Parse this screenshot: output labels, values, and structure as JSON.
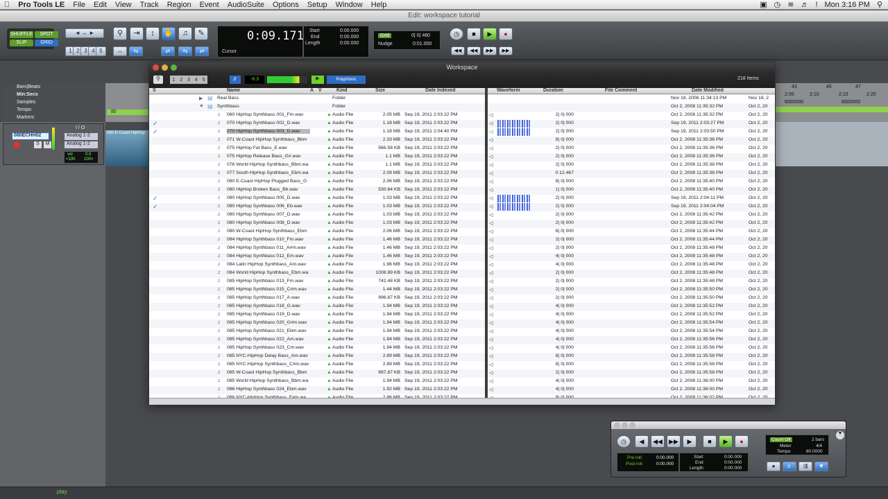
{
  "menubar": {
    "app": "Pro Tools LE",
    "items": [
      "File",
      "Edit",
      "View",
      "Track",
      "Region",
      "Event",
      "AudioSuite",
      "Options",
      "Setup",
      "Window",
      "Help"
    ],
    "clock": "Mon 3:16 PM"
  },
  "edit_window": {
    "title": "Edit: workspace tutorial",
    "modes": [
      "SHUFFLE",
      "SPOT",
      "SLIP",
      "GRID"
    ],
    "zoom_presets": [
      "1",
      "2",
      "3",
      "4",
      "5"
    ],
    "counter": {
      "main": "0:09.171",
      "label": "Cursor"
    },
    "selection": {
      "labels": [
        "Start",
        "End",
        "Length"
      ],
      "values": [
        "0:00.000",
        "0:00.000",
        "0:00.000"
      ]
    },
    "grid": {
      "grid_label": "Grid",
      "grid_value": "0| 0| 480",
      "nudge_label": "Nudge",
      "nudge_value": "0:01.000"
    },
    "rulers": [
      "Bars|Beats",
      "Min:Secs",
      "Samples",
      "Tempo",
      "Markers"
    ],
    "tempo_value": "80",
    "track": {
      "name": "080ECHH02",
      "io_header": "I / O",
      "input": "Analog 1-2",
      "output": "Analog 1-2",
      "vol": "vol",
      "vol_value": "0.0",
      "pan_left": "<100",
      "pan_right": "100>",
      "region_name": "080 E-Coast HipHop"
    },
    "ruler_right": {
      "bars": [
        "43",
        "45",
        "47"
      ],
      "mins": [
        "2:05",
        "2:10",
        "2:15",
        "2:20"
      ],
      "samples": [
        "6000000",
        "6500000"
      ]
    },
    "footer_status": "play"
  },
  "workspace": {
    "title": "Workspace",
    "item_count": "218 Items",
    "pages": [
      "1",
      "2",
      "3",
      "4",
      "5"
    ],
    "preview_level": "-8.3",
    "polyphonic": "Polyphonic",
    "columns": [
      "S",
      "Name",
      "A",
      "V",
      "Kind",
      "Size",
      "Date Indexed",
      "Waveform",
      "Duration",
      "File Comment",
      "Date Modified"
    ],
    "rows": [
      {
        "name": "Real Bass",
        "kind": "Folder",
        "size": "",
        "indexed": "",
        "duration": "",
        "modified": "Nov 18, 2008 11:34:13 PM",
        "modified2": "Nov 18, 2",
        "folder": true,
        "open": false
      },
      {
        "name": "Synthbass",
        "kind": "Folder",
        "size": "",
        "indexed": "",
        "duration": "",
        "modified": "Oct 2, 2008 11:35:32 PM",
        "modified2": "Oct 2, 20",
        "folder": true,
        "open": true
      },
      {
        "name": "060 HipHop Synthbass 001_Fm.wav",
        "kind": "Audio File",
        "size": "2.05 MB",
        "indexed": "Sep 19, 2011 2:03:22 PM",
        "duration": "2| 0| 000",
        "modified": "Oct 2, 2008 11:35:32 PM",
        "modified2": "Oct 2, 20"
      },
      {
        "name": "070 HipHop Synthbass 002_D.wav",
        "kind": "Audio File",
        "size": "1.18 MB",
        "indexed": "Sep 19, 2011 2:03:22 PM",
        "duration": "2| 0| 000",
        "modified": "Sep 19, 2011 2:03:27 PM",
        "modified2": "Oct 2, 20",
        "check": true,
        "wave": true
      },
      {
        "name": "070 HipHop Synthbass 003_D.wav",
        "kind": "Audio File",
        "size": "1.18 MB",
        "indexed": "Sep 19, 2011 2:04:40 PM",
        "duration": "2| 0| 000",
        "modified": "Sep 19, 2011 2:03:50 PM",
        "modified2": "Oct 2, 20",
        "check": true,
        "selected": true,
        "playing": true
      },
      {
        "name": "071 W-Coast HipHop Synthbass_Bbm",
        "kind": "Audio File",
        "size": "2.33 MB",
        "indexed": "Sep 19, 2011 2:03:22 PM",
        "duration": "8| 0| 000",
        "modified": "Oct 2, 2008 11:35:36 PM",
        "modified2": "Oct 2, 20"
      },
      {
        "name": "075 HipHop Fat Bass_E.wav",
        "kind": "Audio File",
        "size": "566.58 KB",
        "indexed": "Sep 19, 2011 2:03:22 PM",
        "duration": "2| 0| 000",
        "modified": "Oct 2, 2008 11:35:36 PM",
        "modified2": "Oct 2, 20"
      },
      {
        "name": "075 HipHop Release Bass_G#.wav",
        "kind": "Audio File",
        "size": "1.1 MB",
        "indexed": "Sep 19, 2011 2:03:22 PM",
        "duration": "2| 0| 000",
        "modified": "Oct 2, 2008 11:35:36 PM",
        "modified2": "Oct 2, 20"
      },
      {
        "name": "076 World HipHop Synthbass_Bbm.wa",
        "kind": "Audio File",
        "size": "1.1 MB",
        "indexed": "Sep 19, 2011 2:03:22 PM",
        "duration": "2| 0| 000",
        "modified": "Oct 2, 2008 11:35:38 PM",
        "modified2": "Oct 2, 20"
      },
      {
        "name": "077 South HipHop Synthbass_Ebm.wa",
        "kind": "Audio File",
        "size": "2.09 MB",
        "indexed": "Sep 19, 2011 2:03:22 PM",
        "duration": "0:12.467",
        "modified": "Oct 2, 2008 11:35:38 PM",
        "modified2": "Oct 2, 20",
        "alt": true
      },
      {
        "name": "080 E-Coast HipHop Plugged Bass_G",
        "kind": "Audio File",
        "size": "2.06 MB",
        "indexed": "Sep 19, 2011 2:03:22 PM",
        "duration": "8| 0| 000",
        "modified": "Oct 2, 2008 11:35:40 PM",
        "modified2": "Oct 2, 20"
      },
      {
        "name": "080 HipHop Broken Bass_Bb.wav",
        "kind": "Audio File",
        "size": "530.64 KB",
        "indexed": "Sep 19, 2011 2:03:22 PM",
        "duration": "1| 0| 000",
        "modified": "Oct 2, 2008 11:35:40 PM",
        "modified2": "Oct 2, 20"
      },
      {
        "name": "080 HipHop Synthbass 005_D.wav",
        "kind": "Audio File",
        "size": "1.03 MB",
        "indexed": "Sep 19, 2011 2:03:22 PM",
        "duration": "2| 0| 000",
        "modified": "Sep 19, 2011 2:04:11 PM",
        "modified2": "Oct 2, 20",
        "check": true,
        "wave": true
      },
      {
        "name": "080 HipHop Synthbass 006_Eb.wav",
        "kind": "Audio File",
        "size": "1.03 MB",
        "indexed": "Sep 19, 2011 2:03:22 PM",
        "duration": "2| 0| 000",
        "modified": "Sep 19, 2011 2:04:04 PM",
        "modified2": "Oct 2, 20",
        "check": true,
        "wave": true
      },
      {
        "name": "080 HipHop Synthbass 007_D.wav",
        "kind": "Audio File",
        "size": "1.03 MB",
        "indexed": "Sep 19, 2011 2:03:22 PM",
        "duration": "2| 0| 000",
        "modified": "Oct 2, 2008 11:35:42 PM",
        "modified2": "Oct 2, 20"
      },
      {
        "name": "080 HipHop Synthbass 008_D.wav",
        "kind": "Audio File",
        "size": "1.03 MB",
        "indexed": "Sep 19, 2011 2:03:22 PM",
        "duration": "2| 0| 000",
        "modified": "Oct 2, 2008 11:35:42 PM",
        "modified2": "Oct 2, 20"
      },
      {
        "name": "080 W-Coast HipHop Synthbass_Ebm",
        "kind": "Audio File",
        "size": "2.06 MB",
        "indexed": "Sep 19, 2011 2:03:22 PM",
        "duration": "8| 0| 000",
        "modified": "Oct 2, 2008 11:35:44 PM",
        "modified2": "Oct 2, 20"
      },
      {
        "name": "084 HipHop Synthbass 010_Fm.wav",
        "kind": "Audio File",
        "size": "1.46 MB",
        "indexed": "Sep 19, 2011 2:03:22 PM",
        "duration": "2| 0| 000",
        "modified": "Oct 2, 2008 11:35:44 PM",
        "modified2": "Oct 2, 20"
      },
      {
        "name": "084 HipHop Synthbass 011_A#m.wav",
        "kind": "Audio File",
        "size": "1.46 MB",
        "indexed": "Sep 19, 2011 2:03:22 PM",
        "duration": "2| 0| 000",
        "modified": "Oct 2, 2008 11:35:48 PM",
        "modified2": "Oct 2, 20"
      },
      {
        "name": "084 HipHop Synthbass 012_Em.wav",
        "kind": "Audio File",
        "size": "1.46 MB",
        "indexed": "Sep 19, 2011 2:03:22 PM",
        "duration": "4| 0| 000",
        "modified": "Oct 2, 2008 11:35:48 PM",
        "modified2": "Oct 2, 20"
      },
      {
        "name": "084 Latin HipHop Synthbass_Am.wav",
        "kind": "Audio File",
        "size": "1.96 MB",
        "indexed": "Sep 19, 2011 2:03:22 PM",
        "duration": "4| 0| 000",
        "modified": "Oct 2, 2008 11:35:48 PM",
        "modified2": "Oct 2, 20"
      },
      {
        "name": "084 World HipHop Synthbass_Ebm.wa",
        "kind": "Audio File",
        "size": "1008.89 KB",
        "indexed": "Sep 19, 2011 2:03:22 PM",
        "duration": "2| 0| 000",
        "modified": "Oct 2, 2008 11:35:48 PM",
        "modified2": "Oct 2, 20"
      },
      {
        "name": "085 HipHop Synthbass 013_Fm.wav",
        "kind": "Audio File",
        "size": "742.48 KB",
        "indexed": "Sep 19, 2011 2:03:22 PM",
        "duration": "2| 0| 000",
        "modified": "Oct 2, 2008 11:35:48 PM",
        "modified2": "Oct 2, 20"
      },
      {
        "name": "085 HipHop Synthbass 015_C#m.wav",
        "kind": "Audio File",
        "size": "1.44 MB",
        "indexed": "Sep 19, 2011 2:03:22 PM",
        "duration": "2| 0| 000",
        "modified": "Oct 2, 2008 11:35:50 PM",
        "modified2": "Oct 2, 20"
      },
      {
        "name": "085 HipHop Synthbass 017_A.wav",
        "kind": "Audio File",
        "size": "996.87 KB",
        "indexed": "Sep 19, 2011 2:03:22 PM",
        "duration": "2| 0| 000",
        "modified": "Oct 2, 2008 11:35:50 PM",
        "modified2": "Oct 2, 20"
      },
      {
        "name": "085 HipHop Synthbass 018_G.wav",
        "kind": "Audio File",
        "size": "1.94 MB",
        "indexed": "Sep 19, 2011 2:03:22 PM",
        "duration": "4| 0| 000",
        "modified": "Oct 2, 2008 11:35:52 PM",
        "modified2": "Oct 2, 20"
      },
      {
        "name": "085 HipHop Synthbass 019_D.wav",
        "kind": "Audio File",
        "size": "1.94 MB",
        "indexed": "Sep 19, 2011 2:03:22 PM",
        "duration": "4| 0| 000",
        "modified": "Oct 2, 2008 11:35:52 PM",
        "modified2": "Oct 2, 20"
      },
      {
        "name": "085 HipHop Synthbass 020_G#m.wav",
        "kind": "Audio File",
        "size": "1.94 MB",
        "indexed": "Sep 19, 2011 2:03:22 PM",
        "duration": "4| 0| 000",
        "modified": "Oct 2, 2008 11:35:54 PM",
        "modified2": "Oct 2, 20"
      },
      {
        "name": "085 HipHop Synthbass 021_Ebm.wav",
        "kind": "Audio File",
        "size": "1.94 MB",
        "indexed": "Sep 19, 2011 2:03:22 PM",
        "duration": "4| 0| 000",
        "modified": "Oct 2, 2008 11:35:54 PM",
        "modified2": "Oct 2, 20"
      },
      {
        "name": "085 HipHop Synthbass 022_Am.wav",
        "kind": "Audio File",
        "size": "1.94 MB",
        "indexed": "Sep 19, 2011 2:03:22 PM",
        "duration": "4| 0| 000",
        "modified": "Oct 2, 2008 11:35:56 PM",
        "modified2": "Oct 2, 20"
      },
      {
        "name": "085 HipHop Synthbass 023_Cm.wav",
        "kind": "Audio File",
        "size": "1.94 MB",
        "indexed": "Sep 19, 2011 2:03:22 PM",
        "duration": "4| 0| 000",
        "modified": "Oct 2, 2008 11:35:56 PM",
        "modified2": "Oct 2, 20"
      },
      {
        "name": "085 NYC-HipHop Delay Bass_Am.wav",
        "kind": "Audio File",
        "size": "2.89 MB",
        "indexed": "Sep 19, 2011 2:03:22 PM",
        "duration": "8| 0| 000",
        "modified": "Oct 2, 2008 11:35:58 PM",
        "modified2": "Oct 2, 20"
      },
      {
        "name": "085 NYC-HipHop Synthbass_C#m.wav",
        "kind": "Audio File",
        "size": "2.89 MB",
        "indexed": "Sep 19, 2011 2:03:22 PM",
        "duration": "8| 0| 000",
        "modified": "Oct 2, 2008 11:35:58 PM",
        "modified2": "Oct 2, 20"
      },
      {
        "name": "085 W-Coast HipHop Synthbass_Bbm",
        "kind": "Audio File",
        "size": "997.87 KB",
        "indexed": "Sep 19, 2011 2:03:22 PM",
        "duration": "2| 0| 000",
        "modified": "Oct 2, 2008 11:35:58 PM",
        "modified2": "Oct 2, 20"
      },
      {
        "name": "085 World HipHop Synthbass_Bbm.wa",
        "kind": "Audio File",
        "size": "1.94 MB",
        "indexed": "Sep 19, 2011 2:03:22 PM",
        "duration": "4| 0| 000",
        "modified": "Oct 2, 2008 11:36:00 PM",
        "modified2": "Oct 2, 20"
      },
      {
        "name": "086 HipHop Synthbass 024_Ebm.wav",
        "kind": "Audio File",
        "size": "1.92 MB",
        "indexed": "Sep 19, 2011 2:03:22 PM",
        "duration": "4| 0| 000",
        "modified": "Oct 2, 2008 11:36:00 PM",
        "modified2": "Oct 2, 20"
      },
      {
        "name": "086 NYC-HipHop Synthbass_F#m.wa",
        "kind": "Audio File",
        "size": "2.86 MB",
        "indexed": "Sep 19, 2011 2:03:22 PM",
        "duration": "8| 0| 000",
        "modified": "Oct 2, 2008 11:36:02 PM",
        "modified2": "Oct 2, 20"
      }
    ]
  },
  "transport": {
    "preroll_label": "Pre-roll",
    "postroll_label": "Post-roll",
    "preroll": "0:00.000",
    "postroll": "0:00.000",
    "labels": [
      "Start",
      "End",
      "Length"
    ],
    "values": [
      "0:00.000",
      "0:00.000",
      "0:00.000"
    ],
    "countoff": "Count Off",
    "countoff_val": "2 bars",
    "meter": "Meter",
    "meter_val": "4/4",
    "tempo": "Tempo",
    "tempo_val": "80.0000"
  },
  "colors": {
    "accent_green": "#6ed22a",
    "accent_blue": "#2e6cc2",
    "check_blue": "#2a6fd6"
  }
}
